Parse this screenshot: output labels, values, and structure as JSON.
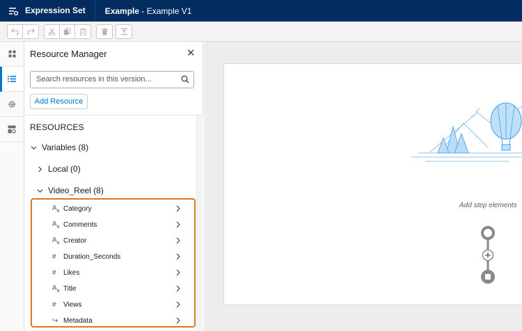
{
  "header": {
    "app_name": "Expression Set",
    "doc_title_bold": "Example",
    "doc_title_rest": " - Example V1"
  },
  "toolbar": {
    "buttons": [
      "undo-icon",
      "redo-icon",
      "cut-icon",
      "copy-icon",
      "paste-icon",
      "delete-icon",
      "align-icon"
    ]
  },
  "nav": {
    "items": [
      "elements-icon",
      "resources-icon",
      "settings-icon",
      "layout-icon"
    ],
    "active": "resources-icon"
  },
  "panel": {
    "title": "Resource Manager",
    "search_placeholder": "Search resources in this version...",
    "add_button": "Add Resource",
    "section_title": "RESOURCES",
    "variables_label": "Variables (8)",
    "local_label": "Local (0)",
    "video_reel_label": "Video_Reel (8)",
    "items": [
      {
        "type": "text",
        "label": "Category"
      },
      {
        "type": "text",
        "label": "Comments"
      },
      {
        "type": "text",
        "label": "Creator"
      },
      {
        "type": "number",
        "label": "Duration_Seconds"
      },
      {
        "type": "number",
        "label": "Likes"
      },
      {
        "type": "text",
        "label": "Title"
      },
      {
        "type": "number",
        "label": "Views"
      },
      {
        "type": "lookup",
        "label": "Metadata"
      }
    ]
  },
  "canvas": {
    "empty_text": "Add step elements"
  },
  "colors": {
    "header_bg": "#032d60",
    "accent": "#0176d3",
    "highlight": "#d97a1a"
  }
}
